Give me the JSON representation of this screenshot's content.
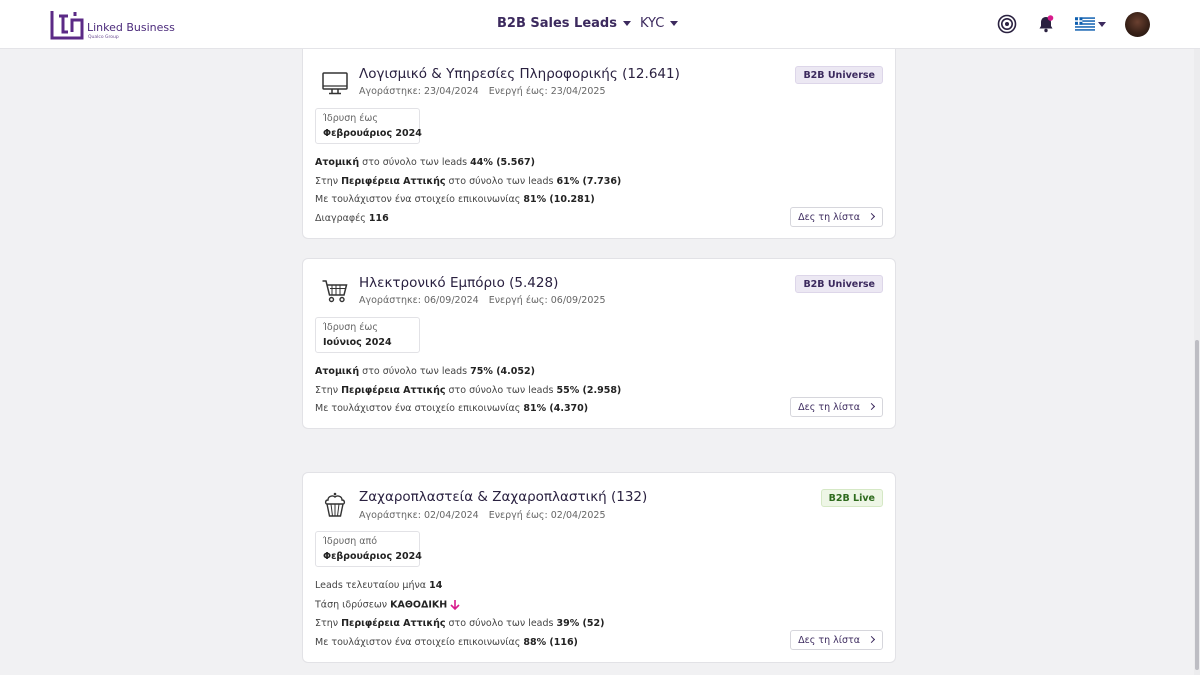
{
  "header": {
    "logo_text": "Linked Business",
    "logo_sub": "Qualco Group",
    "nav_main": "B2B Sales Leads",
    "nav_kyc": "KYC",
    "icons": [
      "target-icon",
      "bell-icon",
      "greek-flag-icon",
      "avatar"
    ],
    "accent_color": "#5b2a86"
  },
  "cards": [
    {
      "icon": "monitor-icon",
      "title": "Λογισμικό & Υπηρεσίες Πληροφορικής (12.641)",
      "purchased": "Αγοράστηκε: 23/04/2024",
      "active_until": "Ενεργή έως: 23/04/2025",
      "badge": "B2B Universe",
      "founded_label": "Ίδρυση έως",
      "founded_value": "Φεβρουάριος 2024",
      "stats": [
        {
          "bold_pre": "Ατομική",
          "text": " στο σύνολο των leads ",
          "value": "44% (5.567)"
        },
        {
          "pre": "Στην ",
          "bold_mid": "Περιφέρεια Αττικής",
          "text": " στο σύνολο των leads ",
          "value": "61% (7.736)"
        },
        {
          "text": "Με τουλάχιστον ένα στοιχείο επικοινωνίας ",
          "value": "81% (10.281)"
        },
        {
          "text": "Διαγραφές ",
          "value": "116"
        }
      ],
      "button": "Δες τη λίστα"
    },
    {
      "icon": "shopping-cart-icon",
      "title": "Ηλεκτρονικό Εμπόριο (5.428)",
      "purchased": "Αγοράστηκε: 06/09/2024",
      "active_until": "Ενεργή έως: 06/09/2025",
      "badge": "B2B Universe",
      "founded_label": "Ίδρυση έως",
      "founded_value": "Ιούνιος 2024",
      "stats": [
        {
          "bold_pre": "Ατομική",
          "text": " στο σύνολο των leads ",
          "value": "75% (4.052)"
        },
        {
          "pre": "Στην ",
          "bold_mid": "Περιφέρεια Αττικής",
          "text": " στο σύνολο των leads ",
          "value": "55% (2.958)"
        },
        {
          "text": "Με τουλάχιστον ένα στοιχείο επικοινωνίας ",
          "value": "81% (4.370)"
        }
      ],
      "button": "Δες τη λίστα"
    },
    {
      "icon": "cupcake-icon",
      "title": "Ζαχαροπλαστεία & Ζαχαροπλαστική (132)",
      "purchased": "Αγοράστηκε: 02/04/2024",
      "active_until": "Ενεργή έως: 02/04/2025",
      "badge": "B2B Live",
      "founded_label": "Ίδρυση από",
      "founded_value": "Φεβρουάριος 2024",
      "stats": [
        {
          "text": "Leads τελευταίου μήνα ",
          "value": "14"
        },
        {
          "text": "Τάση ιδρύσεων ",
          "value": "ΚΑΘΟΔΙΚΗ",
          "trend_icon": "arrow-down-icon"
        },
        {
          "pre": "Στην ",
          "bold_mid": "Περιφέρεια Αττικής",
          "text": " στο σύνολο των leads ",
          "value": "39% (52)"
        },
        {
          "text": "Με τουλάχιστον ένα στοιχείο επικοινωνίας ",
          "value": "88% (116)"
        }
      ],
      "button": "Δες τη λίστα"
    }
  ]
}
